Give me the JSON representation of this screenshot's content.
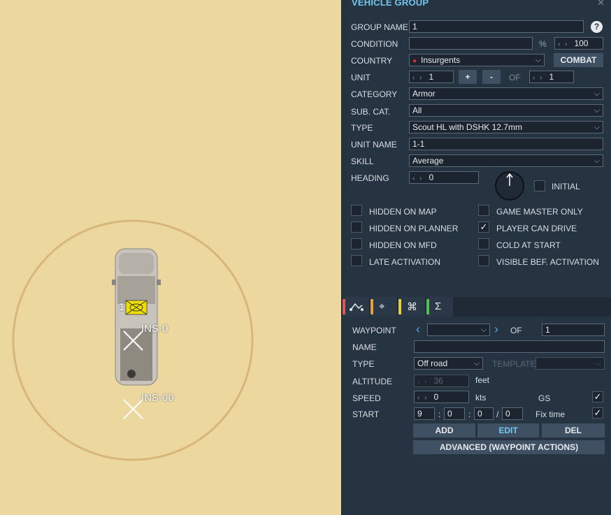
{
  "map": {
    "unit_number": "1",
    "waypoint_labels": [
      "INS-0",
      "INS-00"
    ],
    "range_color": "#d8b67a"
  },
  "panel": {
    "title": "VEHICLE GROUP",
    "close_icon": "close-icon",
    "fields": {
      "group_name": {
        "label": "GROUP NAME",
        "value": "1"
      },
      "condition": {
        "label": "CONDITION",
        "value": "",
        "unit": "%",
        "percent": "100"
      },
      "country": {
        "label": "COUNTRY",
        "value": "Insurgents",
        "combat_label": "COMBAT"
      },
      "unit": {
        "label": "UNIT",
        "value": "1",
        "plus": "+",
        "minus": "-",
        "of_label": "OF",
        "of_value": "1"
      },
      "category": {
        "label": "CATEGORY",
        "value": "Armor"
      },
      "sub_cat": {
        "label": "SUB. CAT.",
        "value": "All"
      },
      "type": {
        "label": "TYPE",
        "value": "Scout HL with DSHK 12.7mm"
      },
      "unit_name": {
        "label": "UNIT NAME",
        "value": "1-1"
      },
      "skill": {
        "label": "SKILL",
        "value": "Average"
      },
      "heading": {
        "label": "HEADING",
        "value": "0",
        "initial_label": "INITIAL"
      }
    },
    "checkboxes": [
      {
        "label": "HIDDEN ON MAP",
        "checked": false
      },
      {
        "label": "HIDDEN ON PLANNER",
        "checked": false
      },
      {
        "label": "HIDDEN ON MFD",
        "checked": false
      },
      {
        "label": "LATE ACTIVATION",
        "checked": false
      },
      {
        "label": "GAME MASTER ONLY",
        "checked": false
      },
      {
        "label": "PLAYER CAN DRIVE",
        "checked": true
      },
      {
        "label": "COLD AT START",
        "checked": false
      },
      {
        "label": "VISIBLE BEF. ACTIVATION",
        "checked": false
      }
    ],
    "check_mark": "✓",
    "tabs": [
      {
        "icon": "route-icon",
        "glyph": "⌒",
        "color": "#e05555"
      },
      {
        "icon": "target-icon",
        "glyph": "⌖",
        "color": "#e0a040"
      },
      {
        "icon": "payload-icon",
        "glyph": "⌘",
        "color": "#e0d040"
      },
      {
        "icon": "summary-icon",
        "glyph": "Σ",
        "color": "#50c050"
      }
    ],
    "waypoint": {
      "label": "WAYPOINT",
      "value": "",
      "of_label": "OF",
      "of_value": "1",
      "name_label": "NAME",
      "name_value": "",
      "type_label": "TYPE",
      "type_value": "Off road",
      "template_label": "TEMPLATE",
      "template_value": "",
      "altitude_label": "ALTITUDE",
      "altitude_value": "36",
      "altitude_unit": "feet",
      "speed_label": "SPEED",
      "speed_value": "0",
      "speed_unit": "kts",
      "gs_label": "GS",
      "gs_checked": true,
      "start_label": "START",
      "start_h": "9",
      "start_m": "0",
      "start_s": "0",
      "start_f": "0",
      "fix_time_label": "Fix time",
      "fix_time_checked": true,
      "add_label": "ADD",
      "edit_label": "EDIT",
      "del_label": "DEL",
      "advanced_label": "ADVANCED (WAYPOINT ACTIONS)"
    }
  }
}
